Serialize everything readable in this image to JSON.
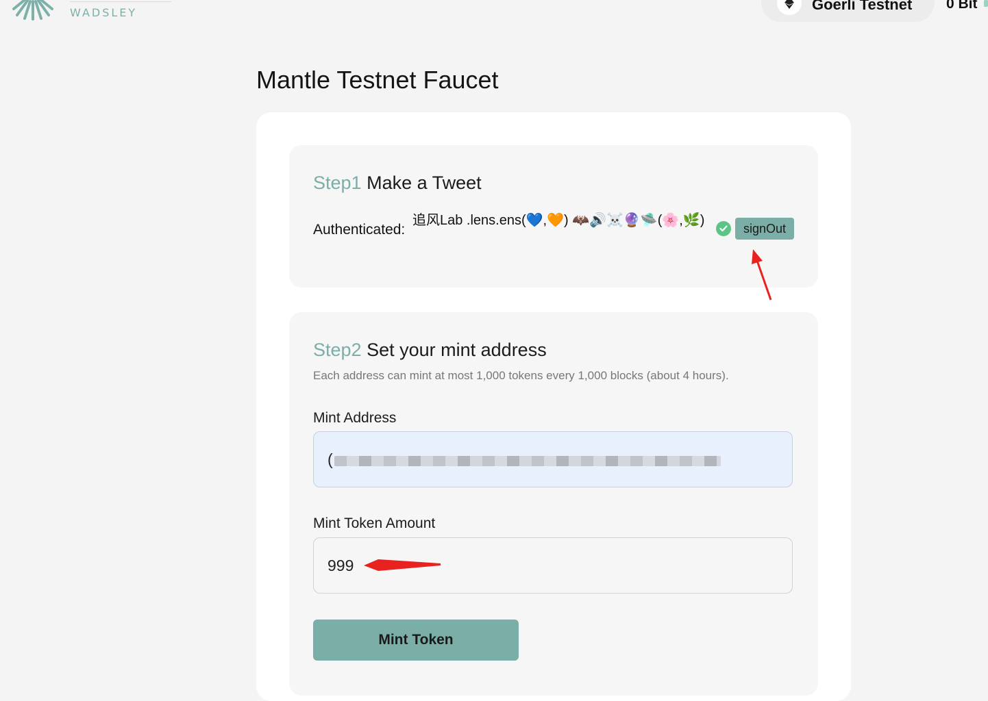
{
  "header": {
    "logo_text": "WADSLEY",
    "network_label": "Goerli Testnet",
    "balance": "0 Bit"
  },
  "page": {
    "title": "Mantle Testnet Faucet"
  },
  "step1": {
    "step_label": "Step1",
    "heading": "Make a Tweet",
    "auth_label": "Authenticated:",
    "auth_value": "追风Lab .lens.ens(💙,🧡) 🦇🔊☠️🔮🛸(🌸,🌿)",
    "signout_label": "signOut"
  },
  "step2": {
    "step_label": "Step2",
    "heading": "Set your mint address",
    "description": "Each address can mint at most 1,000 tokens every 1,000 blocks (about 4 hours).",
    "address_label": "Mint Address",
    "address_value": "(",
    "amount_label": "Mint Token Amount",
    "amount_value": "999",
    "mint_button_label": "Mint Token"
  },
  "colors": {
    "accent": "#7aaea6",
    "background": "#f4f4f4",
    "card": "#ffffff",
    "step_card": "#f6f6f6",
    "address_field_bg": "#e8f0fd",
    "verified": "#5dc486",
    "annotation_arrow": "#e8231f"
  },
  "icons": {
    "logo": "sun-rays-logo-icon",
    "network": "ethereum-icon",
    "verified": "check-badge-icon"
  }
}
